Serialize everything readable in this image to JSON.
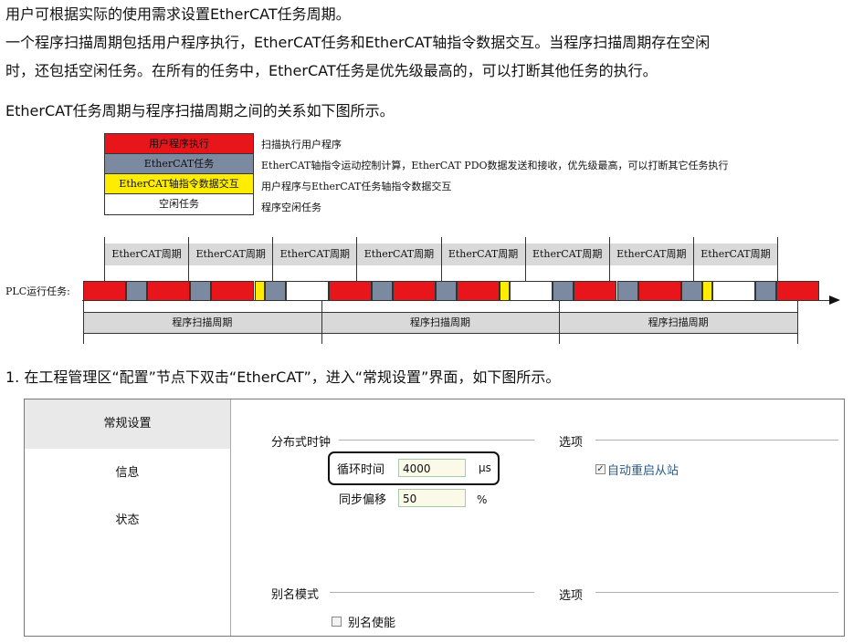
{
  "paragraphs": [
    "用户可根据实际的使用需求设置EtherCAT任务周期。",
    "一个程序扫描周期包括用户程序执行，EtherCAT任务和EtherCAT轴指令数据交互。当程序扫描周期存在空闲",
    "时，还包括空闲任务。在所有的任务中，EtherCAT任务是优先级最高的，可以打断其他任务的执行。",
    "EtherCAT任务周期与程序扫描周期之间的关系如下图所示。",
    "1. 在工程管理区“配置”节点下双击“EtherCAT”，进入“常规设置”界面，如下图所示。"
  ],
  "legend": [
    {
      "name": "用户程序执行",
      "desc": "扫描执行用户程序",
      "color": "#e8161b",
      "text_color": "#111111"
    },
    {
      "name": "EtherCAT任务",
      "desc": "EtherCAT轴指令运动控制计算，EtherCAT PDO数据发送和接收，优先级最高，可以打断其它任务执行",
      "color": "#7b8aa0",
      "text_color": "#111111"
    },
    {
      "name": "EtherCAT轴指令数据交互",
      "desc": "用户程序与EtherCAT任务轴指令数据交互",
      "color": "#ffed00",
      "text_color": "#111111"
    },
    {
      "name": "空闲任务",
      "desc": "程序空闲任务",
      "color": "#ffffff",
      "text_color": "#111111"
    }
  ],
  "timeline": {
    "plc_label": "PLC运行任务:",
    "ethercat_cycle_label": "EtherCAT周期",
    "ethercat_cycle_count": 8,
    "scan_cycle_label": "程序扫描周期",
    "scan_cycle_count": 3,
    "task_sequence": [
      "user",
      "ecat",
      "user",
      "ecat",
      "user",
      "axis",
      "ecat",
      "idle",
      "user",
      "ecat",
      "user",
      "ecat",
      "user",
      "axis",
      "idle",
      "ecat",
      "user",
      "ecat",
      "user",
      "ecat",
      "axis",
      "idle",
      "ecat",
      "user"
    ]
  },
  "dialog": {
    "sidebar": [
      "常规设置",
      "信息",
      "状态"
    ],
    "active_index": 0,
    "dc_group": "分布式时钟",
    "options_group_1": "选项",
    "cycle_time_label": "循环时间",
    "cycle_time_value": "4000",
    "cycle_time_unit": "μs",
    "sync_offset_label": "同步偏移",
    "sync_offset_value": "50",
    "sync_offset_unit": "%",
    "auto_restart_label": "自动重启从站",
    "auto_restart_checked": true,
    "alias_group": "别名模式",
    "options_group_2": "选项",
    "alias_enable_label": "别名使能",
    "alias_enable_checked": false
  }
}
